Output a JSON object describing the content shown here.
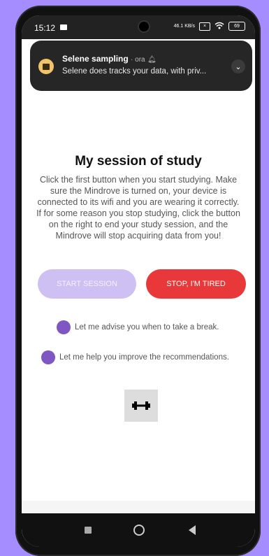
{
  "status_bar": {
    "time": "15:12",
    "net_speed": "46.1 KB/s",
    "battery": "69"
  },
  "notification": {
    "app_name": "Selene sampling",
    "meta": "· ora",
    "text": "Selene does tracks your data, with priv..."
  },
  "main": {
    "title": "My session of study",
    "description": "Click the first button when you start studying. Make sure the Mindrove is turned on, your device is connected to its wifi and you are wearing it correctly. If for some reason you stop studying, click the button on the right to end your study session, and the Mindrove will stop acquiring data from you!",
    "start_button": "START SESSION",
    "stop_button": "STOP, I'M TIRED",
    "options": [
      {
        "label": "Let me advise you when to take a break."
      },
      {
        "label": "Let me help you improve the recommendations."
      }
    ]
  },
  "colors": {
    "accent": "#7e57c2",
    "start_button": "#cfc0f4",
    "stop_button": "#e8383a",
    "background": "#a58cff"
  },
  "icons": {
    "workout": "dumbbell-icon"
  }
}
